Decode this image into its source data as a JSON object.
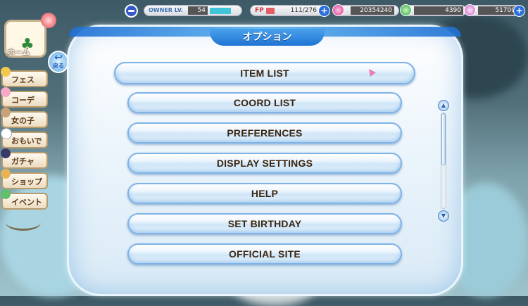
{
  "header": {
    "owner_label": "OWNER LV.",
    "owner_level": "54",
    "owner_progress": 0.75,
    "fp_label": "FP",
    "fp_value": "111/276",
    "fp_progress": 0.4,
    "currency_1": "20354240",
    "currency_2": "4390",
    "currency_3": "51700"
  },
  "sidebar": {
    "home_label": "ホーム",
    "back_label": "戻る",
    "items": [
      {
        "label": "フェス"
      },
      {
        "label": "コーデ"
      },
      {
        "label": "女の子"
      },
      {
        "label": "おもいで"
      },
      {
        "label": "ガチャ"
      },
      {
        "label": "ショップ"
      },
      {
        "label": "イベント"
      }
    ]
  },
  "panel": {
    "title": "オプション",
    "options": [
      {
        "label": "ITEM LIST"
      },
      {
        "label": "COORD LIST"
      },
      {
        "label": "PREFERENCES"
      },
      {
        "label": "DISPLAY SETTINGS"
      },
      {
        "label": "HELP"
      },
      {
        "label": "SET BIRTHDAY"
      },
      {
        "label": "OFFICIAL SITE"
      }
    ],
    "scroll_visible_fraction": 0.55
  },
  "colors": {
    "accent_blue": "#1f74d4",
    "button_text": "#3a2612",
    "fp_bar": "#e35d64",
    "level_bar": "#3fc4d8"
  },
  "icons": {
    "menu": "menu-icon",
    "scroll_up": "scroll-up-icon",
    "scroll_down": "scroll-down-icon",
    "back": "back-arrow-icon"
  }
}
